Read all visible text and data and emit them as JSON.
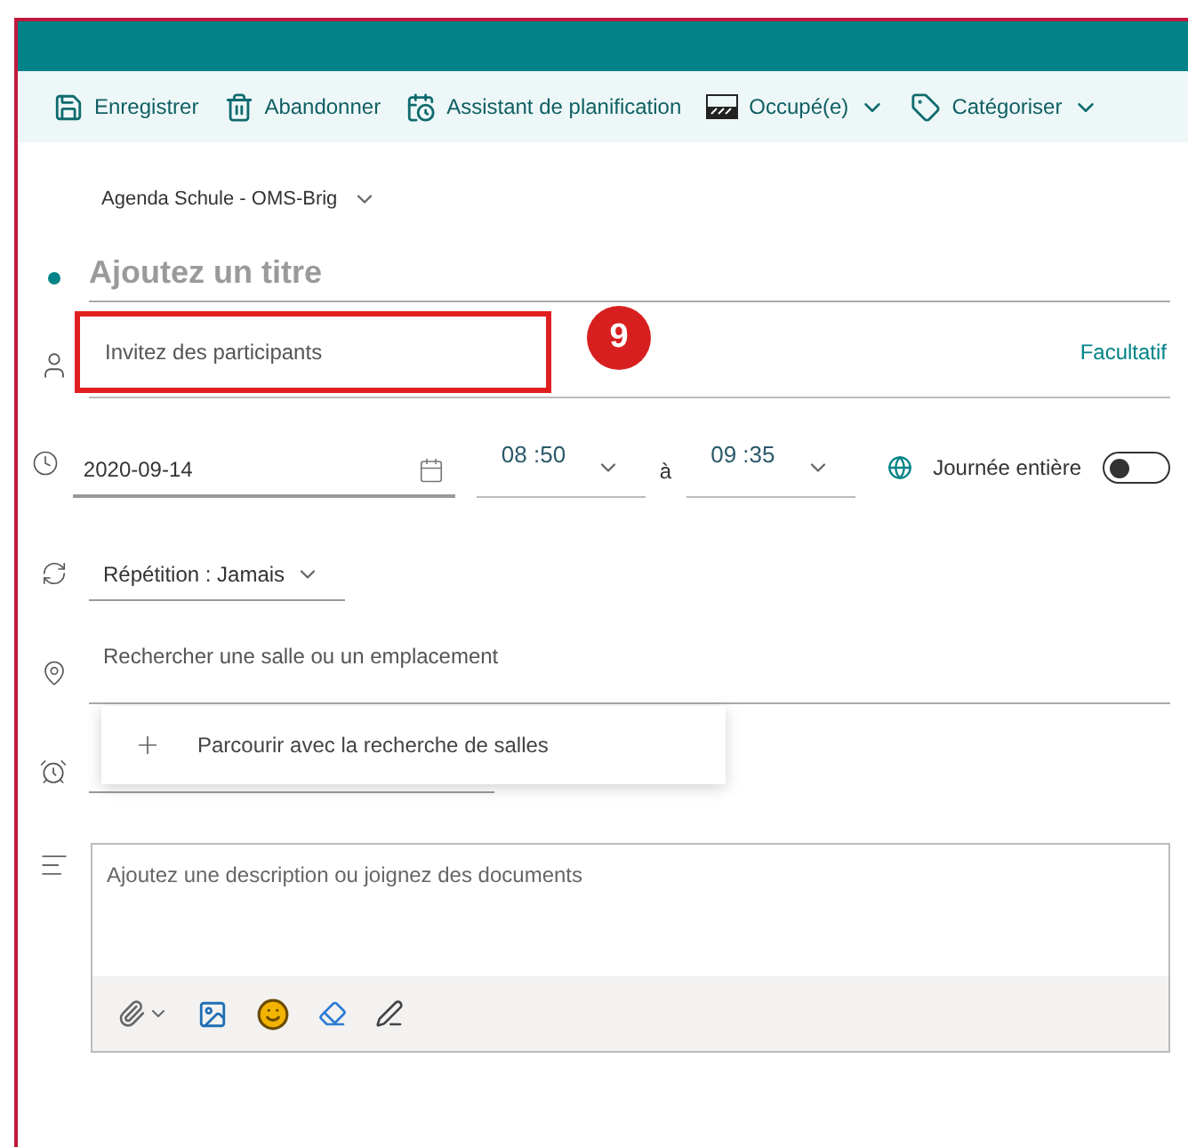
{
  "toolbar": [
    {
      "kind": "save",
      "label": "Enregistrer",
      "dropdown": false
    },
    {
      "kind": "discard",
      "label": "Abandonner",
      "dropdown": false
    },
    {
      "kind": "scheduler",
      "label": "Assistant de planification",
      "dropdown": false
    },
    {
      "kind": "busy",
      "label": "Occupé(e)",
      "dropdown": true
    },
    {
      "kind": "tag",
      "label": "Catégoriser",
      "dropdown": true
    }
  ],
  "calendar": "Agenda Schule - OMS-Brig",
  "title": {
    "placeholder": "Ajoutez un titre"
  },
  "attendees": {
    "placeholder": "Invitez des participants",
    "optional": "Facultatif"
  },
  "annotation": {
    "badge": "9"
  },
  "date": {
    "value": "2020-09-14",
    "start": "08 :50",
    "separator": "à",
    "end": "09 :35",
    "all_day": {
      "label": "Journée entière",
      "on": false
    }
  },
  "repeat": {
    "label": "Répétition :",
    "value": "Jamais"
  },
  "location": {
    "placeholder": "Rechercher une salle ou un emplacement"
  },
  "location_popup": {
    "item": "Parcourir avec la recherche de salles"
  },
  "description": {
    "placeholder": "Ajoutez une description ou joignez des documents"
  }
}
